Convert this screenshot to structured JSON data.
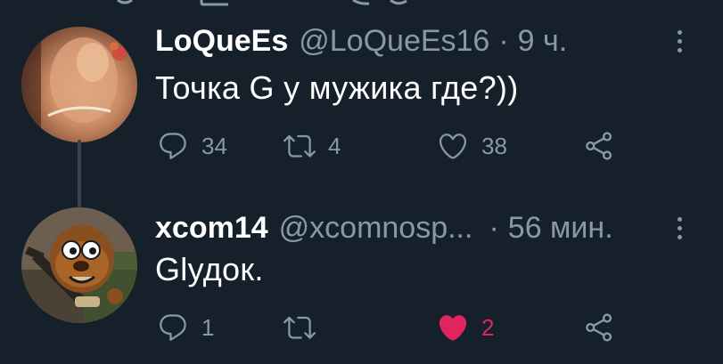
{
  "colors": {
    "background": "#15202b",
    "secondary_text": "#8899a6",
    "primary_text": "#ffffff",
    "like_active": "#e0245e",
    "thread_line": "#38444d"
  },
  "tweets": [
    {
      "display_name": "LoQueEs",
      "handle": "@LoQueEs16",
      "separator": "·",
      "time": "9 ч.",
      "text": "Точка G  у мужика где?))",
      "reply_count": "34",
      "retweet_count": "4",
      "like_count": "38",
      "liked": false,
      "icons": [
        "reply-icon",
        "retweet-icon",
        "heart-icon",
        "share-icon",
        "more-icon"
      ]
    },
    {
      "display_name": "xcom14",
      "handle": "@xcomnosp...",
      "separator": "·",
      "time": "56 мин.",
      "text": "Glудок.",
      "reply_count": "1",
      "retweet_count": "",
      "like_count": "2",
      "liked": true,
      "icons": [
        "reply-icon",
        "retweet-icon",
        "heart-filled-icon",
        "share-icon",
        "more-icon"
      ]
    }
  ]
}
